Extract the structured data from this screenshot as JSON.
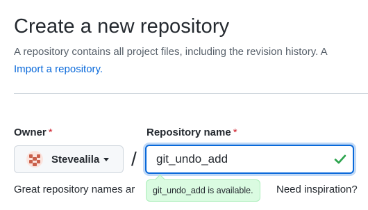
{
  "header": {
    "title": "Create a new repository",
    "subtitle": "A repository contains all project files, including the revision history. A",
    "import_link": "Import a repository."
  },
  "form": {
    "owner_label": "Owner",
    "required_marker": "*",
    "repo_label": "Repository name",
    "owner_value": "Stevealila",
    "separator": "/",
    "repo_value": "git_undo_add",
    "availability_message": "git_undo_add is available.",
    "hint_text": "Great repository names ar",
    "inspiration_text": "Need inspiration?"
  },
  "icons": {
    "owner_avatar": "identicon-avatar",
    "owner_caret": "caret-down-icon",
    "valid": "check-icon"
  },
  "colors": {
    "link": "#0969da",
    "required": "#cf222e",
    "focus_border": "#0969da",
    "success_check": "#2da44e",
    "tooltip_bg": "#dafbe1"
  }
}
